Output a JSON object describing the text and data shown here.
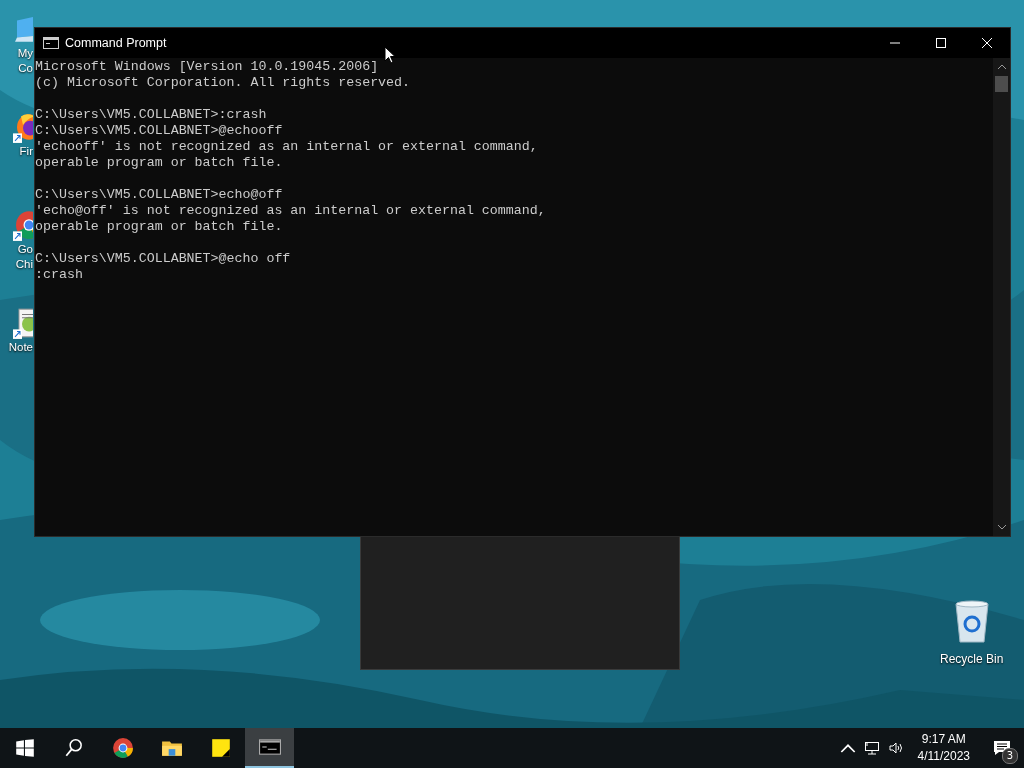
{
  "desktop_icons": [
    {
      "kind": "computer",
      "label": "My Co"
    },
    {
      "kind": "firefox",
      "label": "Fir"
    },
    {
      "kind": "chrome",
      "label": "Go\nChi"
    },
    {
      "kind": "notepad",
      "label": "Note"
    }
  ],
  "recycle_bin": {
    "label": "Recycle Bin"
  },
  "window": {
    "title": "Command Prompt",
    "blocks": [
      [
        "Microsoft Windows [Version 10.0.19045.2006]",
        "(c) Microsoft Corporation. All rights reserved."
      ],
      [
        "C:\\Users\\VM5.COLLABNET>:crash",
        "C:\\Users\\VM5.COLLABNET>@echooff",
        "'echooff' is not recognized as an internal or external command,",
        "operable program or batch file."
      ],
      [
        "C:\\Users\\VM5.COLLABNET>echo@off",
        "'echo@off' is not recognized as an internal or external command,",
        "operable program or batch file."
      ],
      [
        "C:\\Users\\VM5.COLLABNET>@echo off",
        ":crash"
      ]
    ]
  },
  "taskbar": {
    "items": [
      {
        "kind": "start",
        "selected": false
      },
      {
        "kind": "search",
        "selected": false
      },
      {
        "kind": "chrome",
        "selected": false
      },
      {
        "kind": "explorer",
        "selected": false
      },
      {
        "kind": "sticky",
        "selected": false
      },
      {
        "kind": "cmd",
        "selected": true
      }
    ],
    "time": "9:17 AM",
    "date": "4/11/2023",
    "notification_count": "3"
  }
}
